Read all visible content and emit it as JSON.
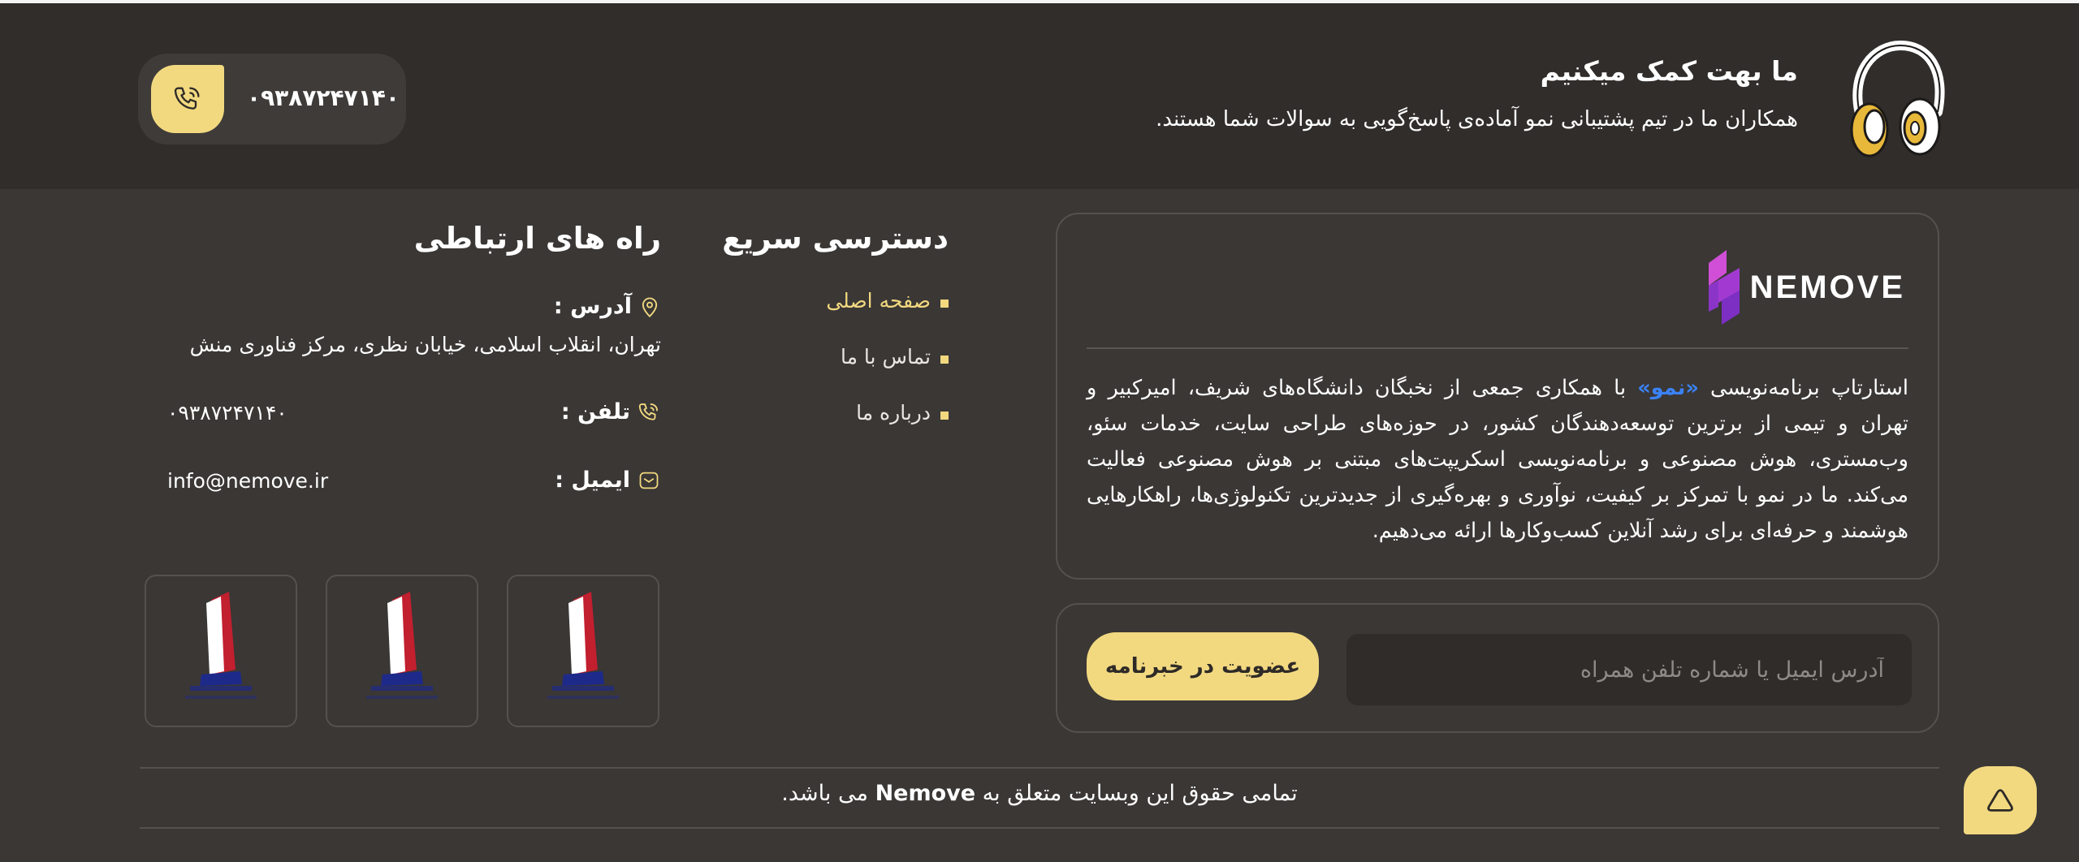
{
  "support": {
    "title": "ما بهت کمک میکنیم",
    "description": "همکاران ما در تیم پشتیبانی نمو آماده‌ی پاسخ‌گویی به سوالات شما هستند.",
    "phone": "۰۹۳۸۷۲۴۷۱۴۰",
    "icon": "headset-icon"
  },
  "about": {
    "logo_text": "NEMOVE",
    "text_before": "استارتاپ برنامه‌نویسی ",
    "brand": "«نمو»",
    "text_after": " با همکاری جمعی از نخبگان دانشگاه‌های شریف، امیرکبیر و تهران و تیمی از برترین توسعه‌دهندگان کشور، در حوزه‌های طراحی سایت، خدمات سئو، وب‌مستری، هوش مصنوعی و برنامه‌نویسی اسکریپت‌های مبتنی بر هوش مصنوعی فعالیت می‌کند. ما در نمو با تمرکز بر کیفیت، نوآوری و بهره‌گیری از جدیدترین تکنولوژی‌ها، راهکارهایی هوشمند و حرفه‌ای برای رشد آنلاین کسب‌وکارها ارائه می‌دهیم."
  },
  "newsletter": {
    "placeholder": "آدرس ایمیل یا شماره تلفن همراه",
    "button_label": "عضویت در خبرنامه"
  },
  "quick_access": {
    "title": "دسترسی سریع",
    "items": [
      {
        "label": "صفحه اصلی",
        "active": true
      },
      {
        "label": "تماس با ما",
        "active": false
      },
      {
        "label": "درباره ما",
        "active": false
      }
    ]
  },
  "contact": {
    "title": "راه های ارتباطی",
    "address_label": "آدرس :",
    "address_value": "تهران، انقلاب اسلامی، خیابان نظری، مرکز فناوری منش",
    "phone_label": "تلفن :",
    "phone_value": "۰۹۳۸۷۲۴۷۱۴۰",
    "email_label": "ایمیل :",
    "email_value": "info@nemove.ir"
  },
  "footer": {
    "copyright_before": "تمامی حقوق این وبسایت متعلق به ",
    "copyright_brand": "Nemove",
    "copyright_after": " می باشد."
  },
  "colors": {
    "background": "#3a3735",
    "band": "#302d2b",
    "accent": "#f2d980",
    "brand_blue": "#3b82f6",
    "logo_purple": "#a23ad1"
  }
}
